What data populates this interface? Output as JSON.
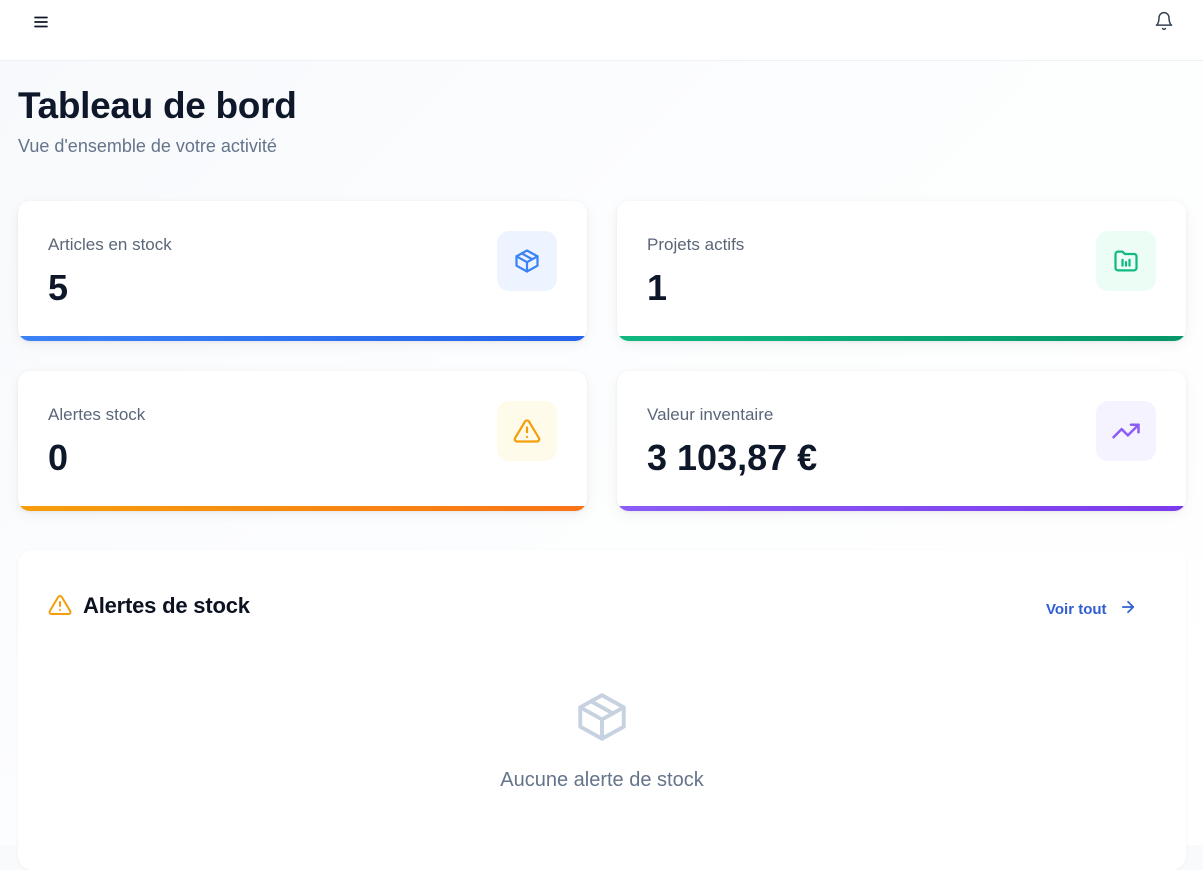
{
  "header": {
    "menu_icon": "hamburger-menu-icon",
    "notifications_icon": "bell-icon"
  },
  "page": {
    "title": "Tableau de bord",
    "subtitle": "Vue d'ensemble de votre activité"
  },
  "stats": [
    {
      "label": "Articles en stock",
      "value": "5",
      "icon": "box-icon",
      "color": "#3b82f6",
      "icon_bg": "#eef4ff"
    },
    {
      "label": "Projets actifs",
      "value": "1",
      "icon": "folder-chart-icon",
      "color": "#10b981",
      "icon_bg": "#ecfdf5"
    },
    {
      "label": "Alertes stock",
      "value": "0",
      "icon": "warning-icon",
      "color": "#f59e0b",
      "icon_bg": "#fffbea"
    },
    {
      "label": "Valeur inventaire",
      "value": "3 103,87 €",
      "icon": "trending-up-icon",
      "color": "#8b5cf6",
      "icon_bg": "#f5f3ff"
    }
  ],
  "alerts_panel": {
    "title": "Alertes de stock",
    "title_icon": "warning-icon",
    "view_all_label": "Voir tout",
    "view_all_icon": "arrow-right-icon",
    "empty_icon": "box-icon",
    "empty_text": "Aucune alerte de stock"
  }
}
